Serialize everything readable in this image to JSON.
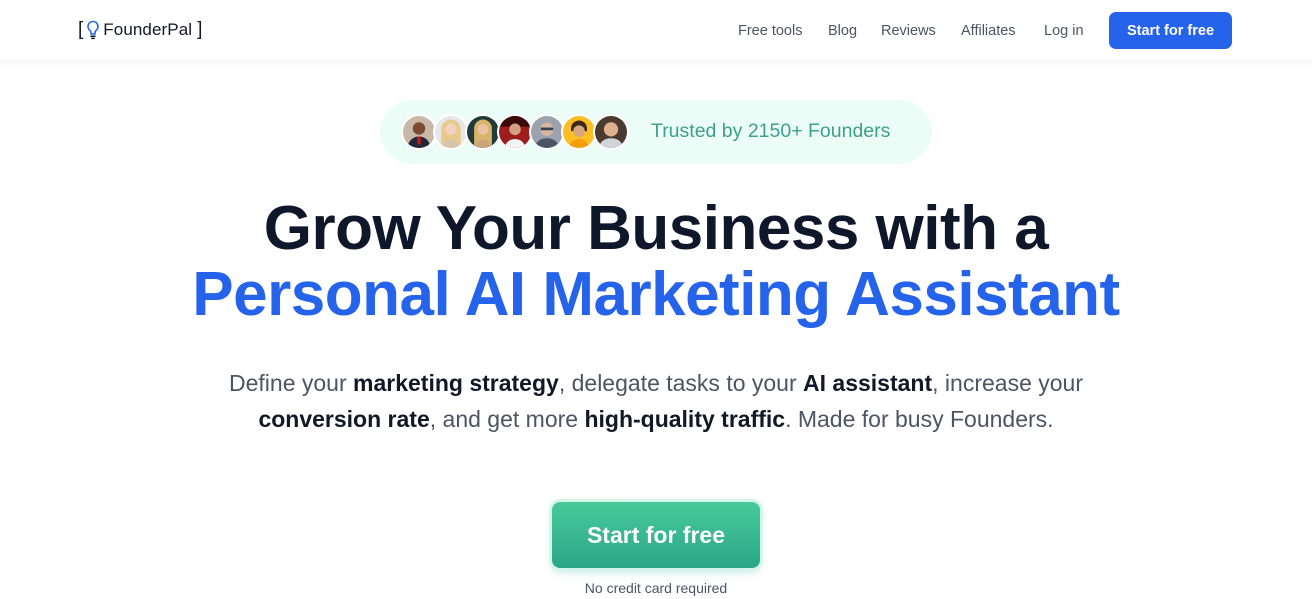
{
  "brand": {
    "name": "FounderPal",
    "bracket_open": "[",
    "bracket_close": "]",
    "logo_icon": "lightbulb-icon",
    "accent_color": "#2563eb"
  },
  "nav": {
    "links": [
      "Free tools",
      "Blog",
      "Reviews",
      "Affiliates",
      "Log in"
    ],
    "cta_label": "Start for free"
  },
  "social_proof": {
    "text": "Trusted by 2150+ Founders",
    "avatar_count": 7,
    "text_color": "#3fa08a"
  },
  "hero": {
    "headline_line1": "Grow Your Business with a",
    "headline_line2": "Personal AI Marketing Assistant",
    "subtext": {
      "p1": "Define your ",
      "b1": "marketing strategy",
      "p2": ", delegate tasks to your ",
      "b2": "AI assistant",
      "p3": ", increase your ",
      "b3": "conversion rate",
      "p4": ", and get more ",
      "b4": "high-quality traffic",
      "p5": ". Made for busy Founders."
    },
    "cta_label": "Start for free",
    "cta_color": "#36b48f",
    "note": "No credit card required"
  }
}
